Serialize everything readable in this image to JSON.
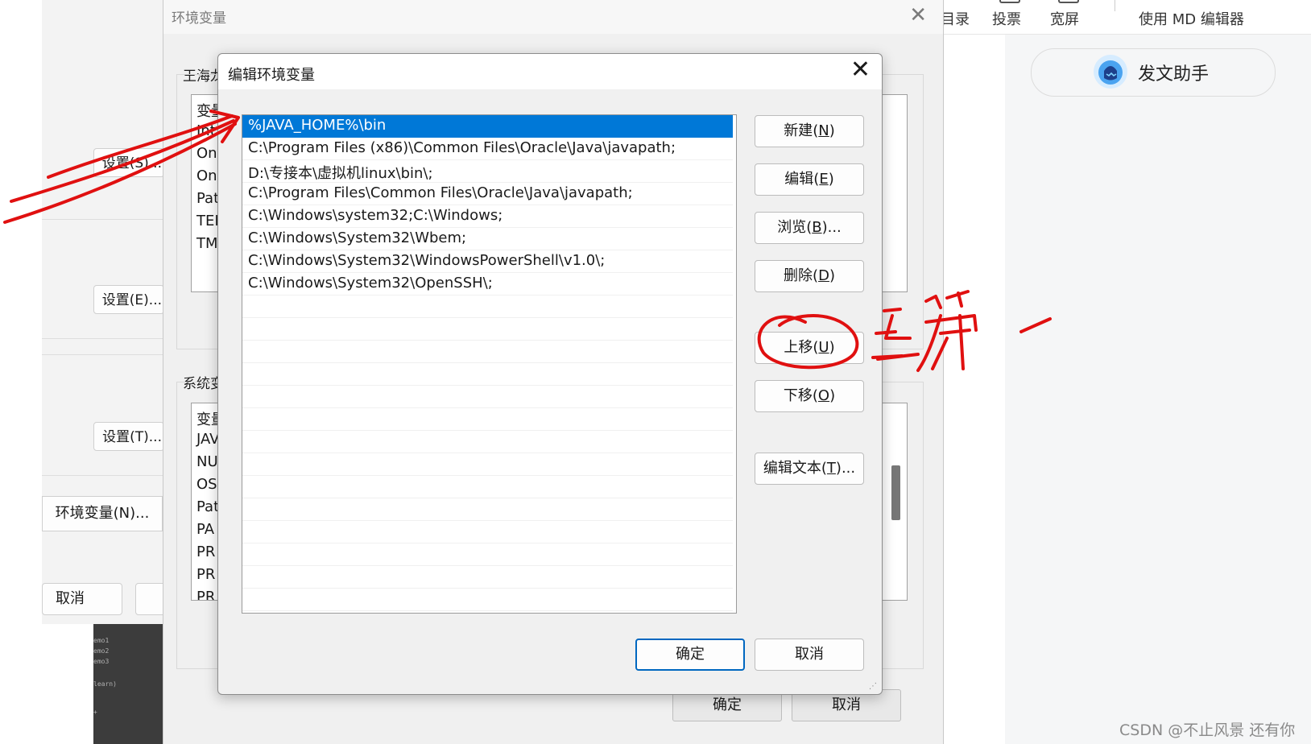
{
  "sys_props": {
    "buttons": [
      "设置(S)...",
      "设置(E)...",
      "设置(T)..."
    ],
    "env_button": "环境变量(N)...",
    "cancel": "取消"
  },
  "editor_strip": {
    "lines": [
      "emo1",
      "emo2",
      "emo3",
      "learn)",
      "+"
    ]
  },
  "env_window": {
    "title": "环境变量",
    "user_group_label": "王海龙",
    "user_vars_partial": [
      "变量",
      "Int",
      "On",
      "On",
      "Pat",
      "TEI",
      "TM"
    ],
    "system_group_label": "系统变",
    "system_vars_partial": [
      "变量",
      "JAV",
      "NU",
      "OS",
      "Pat",
      "PA",
      "PR",
      "PR",
      "PR"
    ],
    "ok": "确定",
    "cancel": "取消"
  },
  "edit_dialog": {
    "title": "编辑环境变量",
    "close": "✕",
    "paths": [
      "%JAVA_HOME%\\bin",
      "C:\\Program Files (x86)\\Common Files\\Oracle\\Java\\javapath;",
      "D:\\专接本\\虚拟机linux\\bin\\;",
      "C:\\Program Files\\Common Files\\Oracle\\Java\\javapath;",
      "C:\\Windows\\system32;C:\\Windows;",
      "C:\\Windows\\System32\\Wbem;",
      "C:\\Windows\\System32\\WindowsPowerShell\\v1.0\\;",
      "C:\\Windows\\System32\\OpenSSH\\;"
    ],
    "selected_index": 0,
    "buttons": {
      "new": {
        "text": "新建(",
        "key": "N",
        "end": ")"
      },
      "edit": {
        "text": "编辑(",
        "key": "E",
        "end": ")"
      },
      "browse": {
        "text": "浏览(",
        "key": "B",
        "end": ")..."
      },
      "delete": {
        "text": "删除(",
        "key": "D",
        "end": ")"
      },
      "move_up": {
        "text": "上移(",
        "key": "U",
        "end": ")"
      },
      "move_down": {
        "text": "下移(",
        "key": "O",
        "end": ")"
      },
      "edit_text": {
        "text": "编辑文本(",
        "key": "T",
        "end": ")..."
      }
    },
    "ok": "确定",
    "cancel": "取消"
  },
  "toolbar": {
    "items": [
      "目录",
      "投票",
      "宽屏",
      "使用 MD 编辑器"
    ]
  },
  "assistant": {
    "label": "发文助手"
  },
  "watermark": "CSDN @不止风景  还有你",
  "colors": {
    "selection": "#0078d7",
    "annotation": "#e01010",
    "primary_border": "#0067c0"
  }
}
